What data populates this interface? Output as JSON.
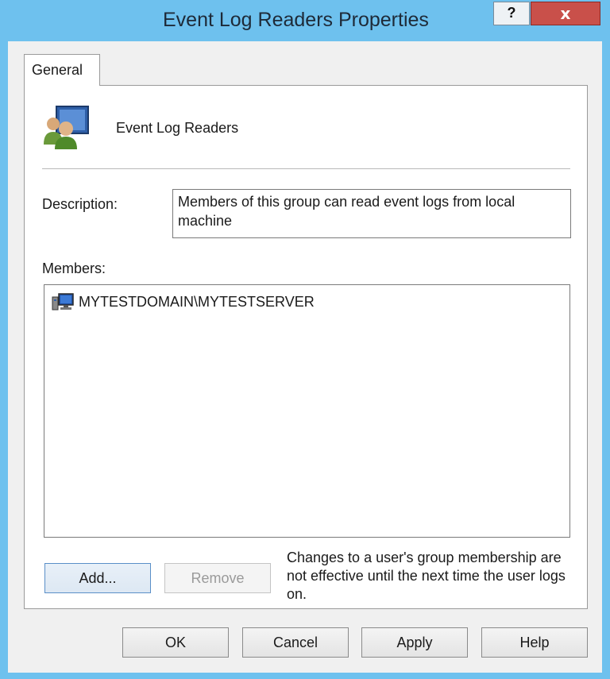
{
  "window": {
    "title": "Event Log Readers Properties",
    "help_glyph": "?",
    "close_glyph": "x",
    "accent_color": "#6ec1ee",
    "close_color": "#c9504a"
  },
  "tabs": [
    {
      "label": "General",
      "selected": true
    }
  ],
  "group": {
    "icon": "users-group-icon",
    "name": "Event Log Readers"
  },
  "description": {
    "label": "Description:",
    "value": "Members of this group can read event logs from local machine"
  },
  "members": {
    "label": "Members:",
    "items": [
      {
        "icon": "computer-account-icon",
        "name": "MYTESTDOMAIN\\MYTESTSERVER"
      }
    ]
  },
  "actions": {
    "add_label": "Add...",
    "remove_label": "Remove",
    "remove_enabled": false,
    "note": "Changes to a user's group membership are not effective until the next time the user logs on."
  },
  "footer": {
    "ok_label": "OK",
    "cancel_label": "Cancel",
    "apply_label": "Apply",
    "help_label": "Help"
  }
}
